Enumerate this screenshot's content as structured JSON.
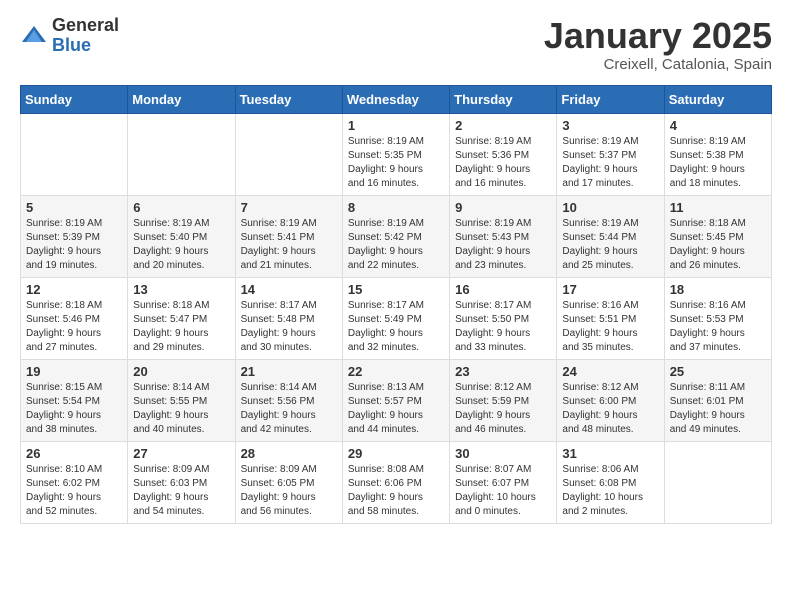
{
  "logo": {
    "general": "General",
    "blue": "Blue"
  },
  "header": {
    "month": "January 2025",
    "location": "Creixell, Catalonia, Spain"
  },
  "weekdays": [
    "Sunday",
    "Monday",
    "Tuesday",
    "Wednesday",
    "Thursday",
    "Friday",
    "Saturday"
  ],
  "weeks": [
    [
      {
        "day": "",
        "info": ""
      },
      {
        "day": "",
        "info": ""
      },
      {
        "day": "",
        "info": ""
      },
      {
        "day": "1",
        "info": "Sunrise: 8:19 AM\nSunset: 5:35 PM\nDaylight: 9 hours\nand 16 minutes."
      },
      {
        "day": "2",
        "info": "Sunrise: 8:19 AM\nSunset: 5:36 PM\nDaylight: 9 hours\nand 16 minutes."
      },
      {
        "day": "3",
        "info": "Sunrise: 8:19 AM\nSunset: 5:37 PM\nDaylight: 9 hours\nand 17 minutes."
      },
      {
        "day": "4",
        "info": "Sunrise: 8:19 AM\nSunset: 5:38 PM\nDaylight: 9 hours\nand 18 minutes."
      }
    ],
    [
      {
        "day": "5",
        "info": "Sunrise: 8:19 AM\nSunset: 5:39 PM\nDaylight: 9 hours\nand 19 minutes."
      },
      {
        "day": "6",
        "info": "Sunrise: 8:19 AM\nSunset: 5:40 PM\nDaylight: 9 hours\nand 20 minutes."
      },
      {
        "day": "7",
        "info": "Sunrise: 8:19 AM\nSunset: 5:41 PM\nDaylight: 9 hours\nand 21 minutes."
      },
      {
        "day": "8",
        "info": "Sunrise: 8:19 AM\nSunset: 5:42 PM\nDaylight: 9 hours\nand 22 minutes."
      },
      {
        "day": "9",
        "info": "Sunrise: 8:19 AM\nSunset: 5:43 PM\nDaylight: 9 hours\nand 23 minutes."
      },
      {
        "day": "10",
        "info": "Sunrise: 8:19 AM\nSunset: 5:44 PM\nDaylight: 9 hours\nand 25 minutes."
      },
      {
        "day": "11",
        "info": "Sunrise: 8:18 AM\nSunset: 5:45 PM\nDaylight: 9 hours\nand 26 minutes."
      }
    ],
    [
      {
        "day": "12",
        "info": "Sunrise: 8:18 AM\nSunset: 5:46 PM\nDaylight: 9 hours\nand 27 minutes."
      },
      {
        "day": "13",
        "info": "Sunrise: 8:18 AM\nSunset: 5:47 PM\nDaylight: 9 hours\nand 29 minutes."
      },
      {
        "day": "14",
        "info": "Sunrise: 8:17 AM\nSunset: 5:48 PM\nDaylight: 9 hours\nand 30 minutes."
      },
      {
        "day": "15",
        "info": "Sunrise: 8:17 AM\nSunset: 5:49 PM\nDaylight: 9 hours\nand 32 minutes."
      },
      {
        "day": "16",
        "info": "Sunrise: 8:17 AM\nSunset: 5:50 PM\nDaylight: 9 hours\nand 33 minutes."
      },
      {
        "day": "17",
        "info": "Sunrise: 8:16 AM\nSunset: 5:51 PM\nDaylight: 9 hours\nand 35 minutes."
      },
      {
        "day": "18",
        "info": "Sunrise: 8:16 AM\nSunset: 5:53 PM\nDaylight: 9 hours\nand 37 minutes."
      }
    ],
    [
      {
        "day": "19",
        "info": "Sunrise: 8:15 AM\nSunset: 5:54 PM\nDaylight: 9 hours\nand 38 minutes."
      },
      {
        "day": "20",
        "info": "Sunrise: 8:14 AM\nSunset: 5:55 PM\nDaylight: 9 hours\nand 40 minutes."
      },
      {
        "day": "21",
        "info": "Sunrise: 8:14 AM\nSunset: 5:56 PM\nDaylight: 9 hours\nand 42 minutes."
      },
      {
        "day": "22",
        "info": "Sunrise: 8:13 AM\nSunset: 5:57 PM\nDaylight: 9 hours\nand 44 minutes."
      },
      {
        "day": "23",
        "info": "Sunrise: 8:12 AM\nSunset: 5:59 PM\nDaylight: 9 hours\nand 46 minutes."
      },
      {
        "day": "24",
        "info": "Sunrise: 8:12 AM\nSunset: 6:00 PM\nDaylight: 9 hours\nand 48 minutes."
      },
      {
        "day": "25",
        "info": "Sunrise: 8:11 AM\nSunset: 6:01 PM\nDaylight: 9 hours\nand 49 minutes."
      }
    ],
    [
      {
        "day": "26",
        "info": "Sunrise: 8:10 AM\nSunset: 6:02 PM\nDaylight: 9 hours\nand 52 minutes."
      },
      {
        "day": "27",
        "info": "Sunrise: 8:09 AM\nSunset: 6:03 PM\nDaylight: 9 hours\nand 54 minutes."
      },
      {
        "day": "28",
        "info": "Sunrise: 8:09 AM\nSunset: 6:05 PM\nDaylight: 9 hours\nand 56 minutes."
      },
      {
        "day": "29",
        "info": "Sunrise: 8:08 AM\nSunset: 6:06 PM\nDaylight: 9 hours\nand 58 minutes."
      },
      {
        "day": "30",
        "info": "Sunrise: 8:07 AM\nSunset: 6:07 PM\nDaylight: 10 hours\nand 0 minutes."
      },
      {
        "day": "31",
        "info": "Sunrise: 8:06 AM\nSunset: 6:08 PM\nDaylight: 10 hours\nand 2 minutes."
      },
      {
        "day": "",
        "info": ""
      }
    ]
  ]
}
